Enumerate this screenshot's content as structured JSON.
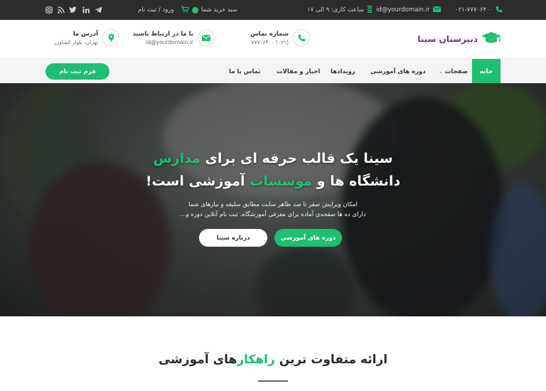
{
  "topbar": {
    "phone": "۰۲۱-۷۷۷۰۶۴۰۰",
    "email": "id@yourdomain.ir",
    "hours": "ساعت کاری: ۹ الی ۱۷",
    "cart": "سبد خرید شما",
    "cart_count": "۰",
    "auth": "ورود / ثبت نام"
  },
  "header": {
    "logo": "دبیرستان سینا",
    "contact_title": "شماره تماس",
    "contact_value": "(۰۲۱) ۷۷۷۰۶۴۰۰",
    "email_title": "با ما در ارتباط باشید",
    "email_value": "id@yourdomain.ir",
    "address_title": "آدرس ما",
    "address_value": "تهران، بلوار کشاورز"
  },
  "nav": {
    "home": "خانه",
    "pages": "صفحات",
    "courses": "دوره های آموزشی",
    "events": "رویدادها",
    "news": "اخبار و مقالات",
    "contact": "تماس با ما",
    "register": "فرم ثبت نام"
  },
  "hero": {
    "line1_a": "سینا یک قالب حرفه ای برای ",
    "line1_b": "مدارس",
    "line2_a": "دانشگاه ها و ",
    "line2_b": "موسسات",
    "line2_c": " آموزشی است!",
    "sub1": "امکان ویرایش صفر تا صد ظاهر سایت مطابق سلیقه و نیازهای شما",
    "sub2": "دارای ده ها صفحه‌ی آماده برای معرفی آموزشگاه، ثبت نام آنلاین دوره و...",
    "btn_courses": "دوره های آموزشی",
    "btn_about": "درباره سینا"
  },
  "section": {
    "title_a": "ارائه متفاوت ترین ",
    "title_b": "راهکار",
    "title_c": "های آموزشی"
  },
  "colors": {
    "accent": "#1dbf73",
    "logo": "#6a2e87",
    "topbar": "#2c2c2c"
  },
  "icons": [
    "instagram-icon",
    "rss-icon",
    "twitter-icon",
    "linkedin-icon",
    "telegram-icon",
    "cart-icon",
    "phone-icon",
    "email-icon",
    "hourglass-icon",
    "map-pin-icon",
    "graduation-cap-icon"
  ]
}
